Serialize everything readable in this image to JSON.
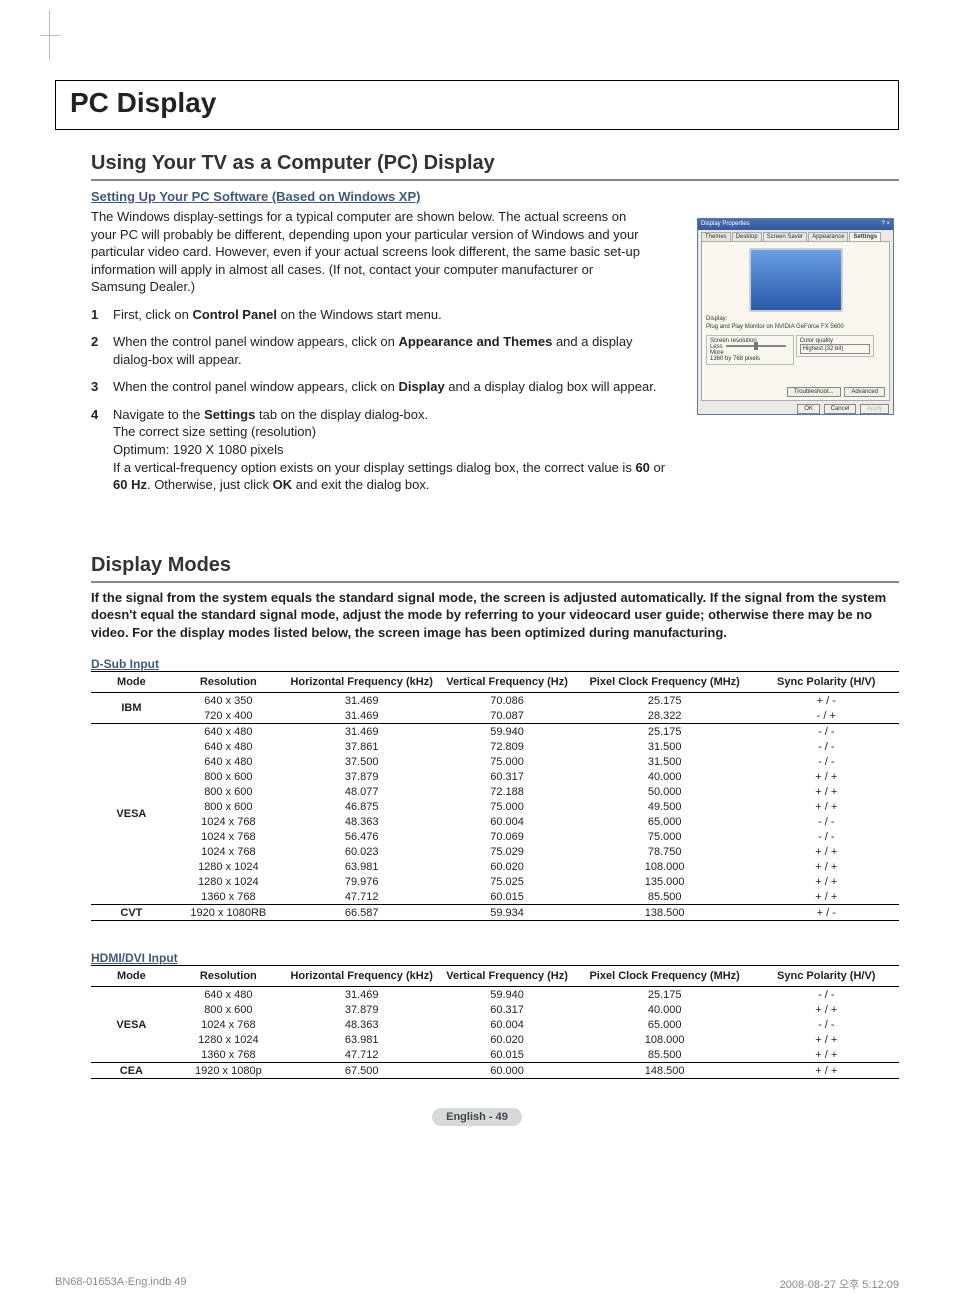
{
  "page_title": "PC Display",
  "section1": {
    "heading": "Using Your TV as a Computer (PC) Display",
    "subheading": "Setting Up Your PC Software (Based on Windows XP)",
    "intro": "The Windows display-settings for a typical computer are shown below. The actual screens on your PC will probably be different, depending upon your particular version of Windows and your particular video card. However, even if your actual screens look different, the same basic set-up information will apply in almost all cases. (If not, contact your computer manufacturer or Samsung Dealer.)",
    "steps": [
      {
        "n": "1",
        "prefix": "First, click on ",
        "bold1": "Control Panel",
        "mid": " on the Windows start menu."
      },
      {
        "n": "2",
        "prefix": "When the control panel window appears, click on ",
        "bold1": "Appearance and Themes",
        "mid": " and a display dialog-box will appear."
      },
      {
        "n": "3",
        "prefix": "When the control panel window appears, click on ",
        "bold1": "Display",
        "mid": " and a display dialog box will appear."
      },
      {
        "n": "4",
        "line1_a": "Navigate to the ",
        "line1_bold": "Settings",
        "line1_b": " tab on the display dialog-box.",
        "line2": "The correct size setting (resolution)",
        "line3": "Optimum: 1920 X 1080 pixels",
        "line4_a": "If a vertical-frequency option exists on your display settings dialog box, the correct value is ",
        "line4_b1": "60",
        "line4_m": " or ",
        "line4_b2": "60 Hz",
        "line4_c": ". Otherwise, just click ",
        "line4_b3": "OK",
        "line4_d": " and exit the dialog box."
      }
    ]
  },
  "dp": {
    "title": "Display Properties",
    "tabs": [
      "Themes",
      "Desktop",
      "Screen Saver",
      "Appearance",
      "Settings"
    ],
    "active_tab": "Settings",
    "display_label": "Display:",
    "display_value": "Plug and Play Monitor on NVIDIA GeForce FX 5600",
    "res_legend": "Screen resolution",
    "res_less": "Less",
    "res_more": "More",
    "res_value": "1360 by 768 pixels",
    "qual_legend": "Color quality",
    "qual_value": "Highest (32 bit)",
    "btn_troubleshoot": "Troubleshoot...",
    "btn_advanced": "Advanced",
    "btn_ok": "OK",
    "btn_cancel": "Cancel",
    "btn_apply": "Apply"
  },
  "section2": {
    "heading": "Display Modes",
    "intro": "If the signal from the system equals the standard signal mode, the screen is adjusted automatically. If the signal from the system doesn't equal the standard signal mode, adjust the mode by referring to your videocard user guide; otherwise there may be no video. For the display modes listed below, the screen image has been optimized during manufacturing."
  },
  "col_headers": {
    "mode": "Mode",
    "res": "Resolution",
    "hfreq": "Horizontal Frequency (kHz)",
    "vfreq": "Vertical Frequency (Hz)",
    "pclk": "Pixel Clock Frequency (MHz)",
    "sync": "Sync Polarity (H/V)"
  },
  "dsub_label": "D-Sub Input",
  "hdmi_label": "HDMI/DVI Input",
  "chart_data": {
    "type": "table",
    "dsub": [
      {
        "mode": "IBM",
        "rows": [
          {
            "res": "640 x 350",
            "h": "31.469",
            "v": "70.086",
            "p": "25.175",
            "s": "+ / -"
          },
          {
            "res": "720 x 400",
            "h": "31.469",
            "v": "70.087",
            "p": "28.322",
            "s": "- / +"
          }
        ]
      },
      {
        "mode": "VESA",
        "rows": [
          {
            "res": "640 x 480",
            "h": "31.469",
            "v": "59.940",
            "p": "25.175",
            "s": "- / -"
          },
          {
            "res": "640 x 480",
            "h": "37.861",
            "v": "72.809",
            "p": "31.500",
            "s": "- / -"
          },
          {
            "res": "640 x 480",
            "h": "37.500",
            "v": "75.000",
            "p": "31.500",
            "s": "- / -"
          },
          {
            "res": "800 x 600",
            "h": "37.879",
            "v": "60.317",
            "p": "40.000",
            "s": "+ / +"
          },
          {
            "res": "800 x 600",
            "h": "48.077",
            "v": "72.188",
            "p": "50.000",
            "s": "+ / +"
          },
          {
            "res": "800 x 600",
            "h": "46.875",
            "v": "75.000",
            "p": "49.500",
            "s": "+ / +"
          },
          {
            "res": "1024 x 768",
            "h": "48.363",
            "v": "60.004",
            "p": "65.000",
            "s": "- / -"
          },
          {
            "res": "1024 x 768",
            "h": "56.476",
            "v": "70.069",
            "p": "75.000",
            "s": "- / -"
          },
          {
            "res": "1024 x 768",
            "h": "60.023",
            "v": "75.029",
            "p": "78.750",
            "s": "+ / +"
          },
          {
            "res": "1280 x 1024",
            "h": "63.981",
            "v": "60.020",
            "p": "108.000",
            "s": "+ / +"
          },
          {
            "res": "1280 x 1024",
            "h": "79.976",
            "v": "75.025",
            "p": "135.000",
            "s": "+ / +"
          },
          {
            "res": "1360 x 768",
            "h": "47.712",
            "v": "60.015",
            "p": "85.500",
            "s": "+ / +"
          }
        ]
      },
      {
        "mode": "CVT",
        "rows": [
          {
            "res": "1920 x 1080RB",
            "h": "66.587",
            "v": "59.934",
            "p": "138.500",
            "s": "+ / -"
          }
        ]
      }
    ],
    "hdmi": [
      {
        "mode": "VESA",
        "rows": [
          {
            "res": "640 x 480",
            "h": "31.469",
            "v": "59.940",
            "p": "25.175",
            "s": "- / -"
          },
          {
            "res": "800 x 600",
            "h": "37.879",
            "v": "60.317",
            "p": "40.000",
            "s": "+ / +"
          },
          {
            "res": "1024 x 768",
            "h": "48.363",
            "v": "60.004",
            "p": "65.000",
            "s": "- / -"
          },
          {
            "res": "1280 x 1024",
            "h": "63.981",
            "v": "60.020",
            "p": "108.000",
            "s": "+ / +"
          },
          {
            "res": "1360 x 768",
            "h": "47.712",
            "v": "60.015",
            "p": "85.500",
            "s": "+ / +"
          }
        ]
      },
      {
        "mode": "CEA",
        "rows": [
          {
            "res": "1920 x 1080p",
            "h": "67.500",
            "v": "60.000",
            "p": "148.500",
            "s": "+ / +"
          }
        ]
      }
    ]
  },
  "page_num": "English - 49",
  "footer": {
    "left": "BN68-01653A-Eng.indb   49",
    "right": "2008-08-27   오후 5:12:09"
  }
}
